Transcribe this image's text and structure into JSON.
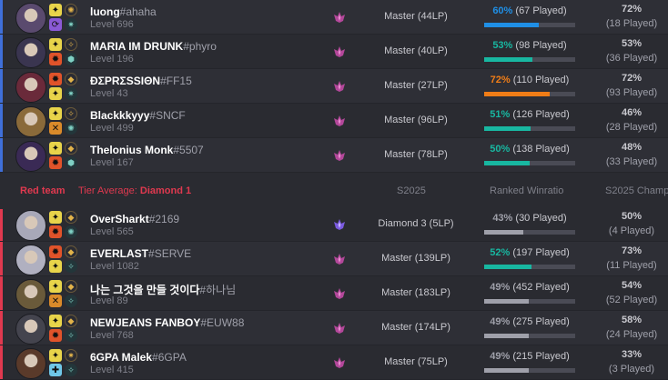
{
  "colors": {
    "blue_team": "#3f6fd9",
    "red_team": "#e0394f",
    "bar_track": "#4a4b55"
  },
  "red_header": {
    "team": "Red team",
    "tier_prefix": "Tier Average:",
    "tier_value": "Diamond 1",
    "col_season": "S2025",
    "col_ranked": "Ranked Winratio",
    "col_champ": "S2025 Champ"
  },
  "players": [
    {
      "team": "blue",
      "name": "luong",
      "tag": "#ahaha",
      "level": "Level 696",
      "rank": "Master (44LP)",
      "rank_tier": "master",
      "wr_pct": "60%",
      "wr_played": "(67 Played)",
      "wr_color": "#1f8fe6",
      "wr_fill": 0.6,
      "cw_pct": "72%",
      "cw_played": "(18 Played)",
      "champ_color": "#5a4a6e",
      "spells": [
        "flash",
        "teleport"
      ],
      "runes": [
        "inspiration",
        "sorcery"
      ]
    },
    {
      "team": "blue",
      "name": "MARIA IM DRUNK",
      "tag": "#phyro",
      "level": "Level 196",
      "rank": "Master (40LP)",
      "rank_tier": "master",
      "wr_pct": "53%",
      "wr_played": "(98 Played)",
      "wr_color": "#18b7a1",
      "wr_fill": 0.53,
      "cw_pct": "53%",
      "cw_played": "(36 Played)",
      "champ_color": "#3a3550",
      "spells": [
        "flash",
        "ignite"
      ],
      "runes": [
        "precision",
        "resolve"
      ]
    },
    {
      "team": "blue",
      "name": "ĐΣPRΣSSIΘN",
      "tag": "#FF15",
      "level": "Level 43",
      "rank": "Master (27LP)",
      "rank_tier": "master",
      "wr_pct": "72%",
      "wr_played": "(110 Played)",
      "wr_color": "#f07d17",
      "wr_fill": 0.72,
      "cw_pct": "72%",
      "cw_played": "(93 Played)",
      "champ_color": "#6a2a3a",
      "spells": [
        "ignite",
        "flash"
      ],
      "runes": [
        "domination",
        "sorcery"
      ]
    },
    {
      "team": "blue",
      "name": "Blackkkyyy",
      "tag": "#SNCF",
      "level": "Level 499",
      "rank": "Master (96LP)",
      "rank_tier": "master",
      "wr_pct": "51%",
      "wr_played": "(126 Played)",
      "wr_color": "#18b7a1",
      "wr_fill": 0.51,
      "cw_pct": "46%",
      "cw_played": "(28 Played)",
      "champ_color": "#8a6a3a",
      "spells": [
        "flash",
        "exhaust"
      ],
      "runes": [
        "precision",
        "inspiration"
      ]
    },
    {
      "team": "blue",
      "name": "Thelonius Monk",
      "tag": "#5507",
      "level": "Level 167",
      "rank": "Master (78LP)",
      "rank_tier": "master",
      "wr_pct": "50%",
      "wr_played": "(138 Played)",
      "wr_color": "#18b7a1",
      "wr_fill": 0.5,
      "cw_pct": "48%",
      "cw_played": "(33 Played)",
      "champ_color": "#3a2a55",
      "spells": [
        "flash",
        "ignite"
      ],
      "runes": [
        "domination",
        "resolve"
      ]
    },
    {
      "team": "red",
      "name": "OverSharkt",
      "tag": "#2169",
      "level": "Level 565",
      "rank": "Diamond 3 (5LP)",
      "rank_tier": "diamond",
      "wr_pct": "43%",
      "wr_played": "(30 Played)",
      "wr_color": "#9fa0aa",
      "wr_fill": 0.43,
      "cw_pct": "50%",
      "cw_played": "(4 Played)",
      "champ_color": "#a8a8b8",
      "spells": [
        "flash",
        "ignite"
      ],
      "runes": [
        "domination",
        "inspiration"
      ]
    },
    {
      "team": "red",
      "name": "EVERLAST",
      "tag": "#SERVE",
      "level": "Level 1082",
      "rank": "Master (139LP)",
      "rank_tier": "master",
      "wr_pct": "52%",
      "wr_played": "(197 Played)",
      "wr_color": "#18b7a1",
      "wr_fill": 0.52,
      "cw_pct": "73%",
      "cw_played": "(11 Played)",
      "champ_color": "#b0b0c0",
      "spells": [
        "ignite",
        "flash"
      ],
      "runes": [
        "domination",
        "precision"
      ]
    },
    {
      "team": "red",
      "name": "나는 그것을 만들 것이다",
      "tag": "#하나님",
      "level": "Level 89",
      "rank": "Master (183LP)",
      "rank_tier": "master",
      "wr_pct": "49%",
      "wr_played": "(452 Played)",
      "wr_color": "#9fa0aa",
      "wr_fill": 0.49,
      "cw_pct": "54%",
      "cw_played": "(52 Played)",
      "champ_color": "#6a5a3a",
      "spells": [
        "flash",
        "exhaust"
      ],
      "runes": [
        "domination",
        "precision"
      ]
    },
    {
      "team": "red",
      "name": "NEWJEANS FANBOY",
      "tag": "#EUW88",
      "level": "Level 768",
      "rank": "Master (174LP)",
      "rank_tier": "master",
      "wr_pct": "49%",
      "wr_played": "(275 Played)",
      "wr_color": "#9fa0aa",
      "wr_fill": 0.49,
      "cw_pct": "58%",
      "cw_played": "(24 Played)",
      "champ_color": "#44444e",
      "spells": [
        "flash",
        "ignite"
      ],
      "runes": [
        "domination",
        "precision"
      ]
    },
    {
      "team": "red",
      "name": "6GPA Malek",
      "tag": "#6GPA",
      "level": "Level 415",
      "rank": "Master (75LP)",
      "rank_tier": "master",
      "wr_pct": "49%",
      "wr_played": "(215 Played)",
      "wr_color": "#9fa0aa",
      "wr_fill": 0.49,
      "cw_pct": "33%",
      "cw_played": "(3 Played)",
      "champ_color": "#5a3a2a",
      "spells": [
        "flash",
        "cleanse"
      ],
      "runes": [
        "sorcery",
        "precision"
      ]
    }
  ]
}
